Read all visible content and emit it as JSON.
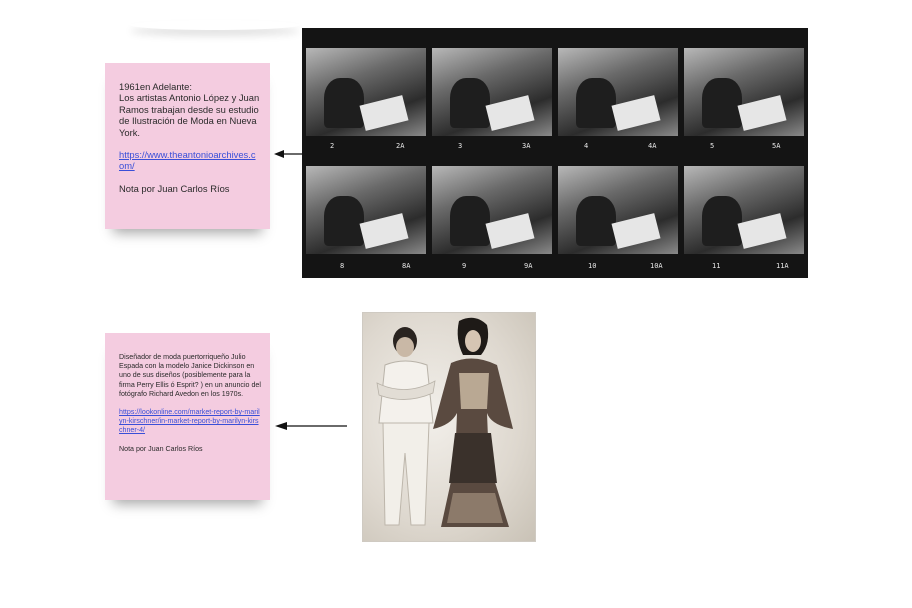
{
  "note_1": {
    "heading": "1961en Adelante:",
    "body": "Los artistas Antonio López y Juan Ramos trabajan desde su estudio de Ilustración de Moda en Nueva York.",
    "link": "https://www.theantonioarchives.com/",
    "signature": "Nota por Juan Carlos Ríos"
  },
  "note_2": {
    "body": "Diseñador de moda puertorriqueño Julio Espada con la modelo Janice Dickinson en uno de sus diseños (posiblemente para la firma Perry Ellis ó Esprit? ) en un anuncio del fotógrafo Richard Avedon en los 1970s.",
    "link": "https://lookonline.com/market-report-by-marilyn-kirschner/in-market-report-by-marilyn-kirschner-4/",
    "signature": "Nota por Juan Carlos Ríos"
  },
  "contact_sheet": {
    "frame_numbers_row1": [
      "2",
      "2A",
      "3",
      "3A",
      "4",
      "4A",
      "5",
      "5A"
    ],
    "frame_numbers_row2": [
      "8",
      "8A",
      "9",
      "9A",
      "10",
      "10A",
      "11",
      "11A"
    ]
  },
  "colors": {
    "note_background": "#f4cce0",
    "link": "#3a4fd8",
    "film": "#141414"
  },
  "icons": [
    "arrow-left-icon"
  ]
}
